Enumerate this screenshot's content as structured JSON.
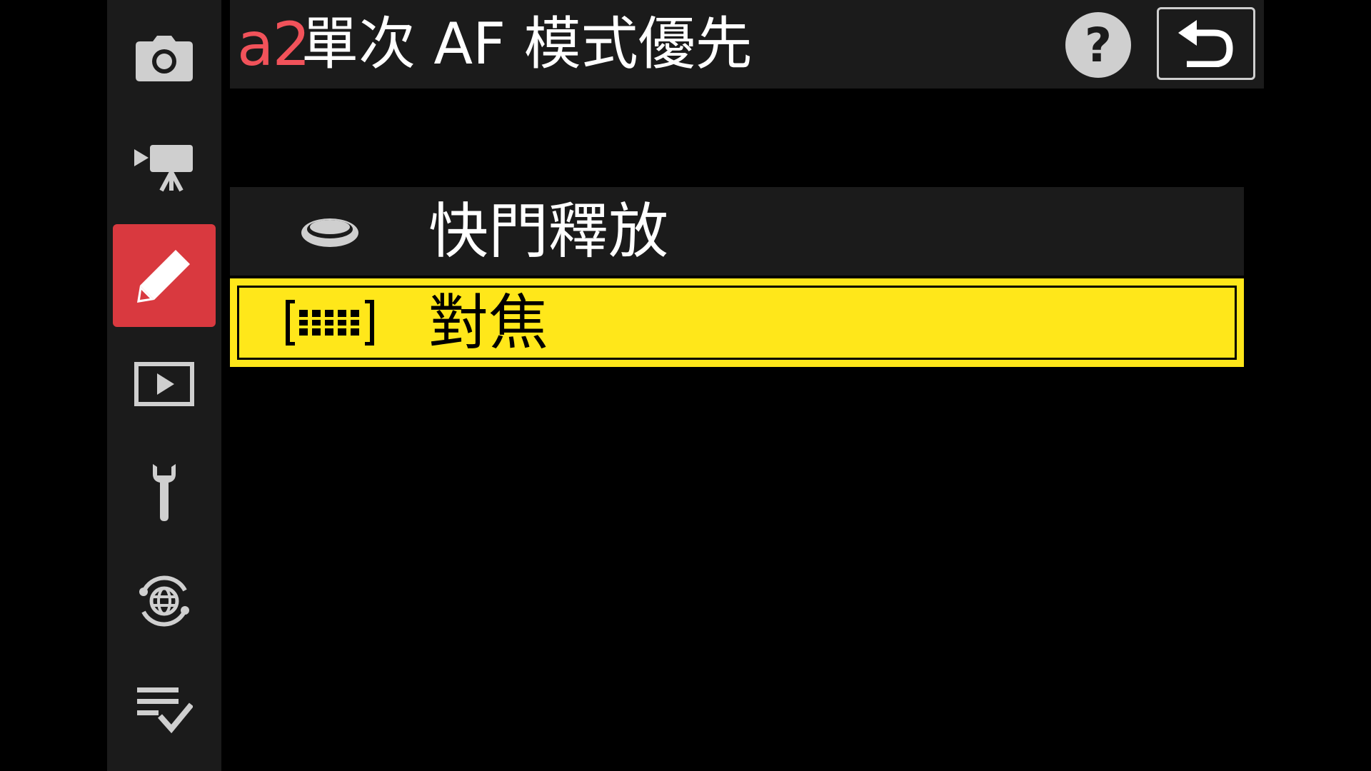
{
  "sidebar": {
    "items": [
      {
        "icon": "camera-icon",
        "active": false
      },
      {
        "icon": "movie-camera-icon",
        "active": false
      },
      {
        "icon": "pencil-icon",
        "active": true
      },
      {
        "icon": "playback-icon",
        "active": false
      },
      {
        "icon": "wrench-icon",
        "active": false
      },
      {
        "icon": "network-globe-icon",
        "active": false
      },
      {
        "icon": "my-menu-checklist-icon",
        "active": false
      }
    ]
  },
  "header": {
    "code": "a2",
    "title": "單次 AF 模式優先",
    "help_label": "?",
    "back_icon": "return-arrow-icon"
  },
  "options": [
    {
      "icon": "shutter-release-icon",
      "label": "快門釋放",
      "selected": false
    },
    {
      "icon": "focus-frame-icon",
      "label": "對焦",
      "selected": true
    }
  ],
  "colors": {
    "background": "#000000",
    "panel": "#1b1b1b",
    "accent_red": "#d9393f",
    "code_red": "#f1525a",
    "highlight_yellow": "#ffe71a",
    "icon_grey": "#cfcfcf"
  }
}
